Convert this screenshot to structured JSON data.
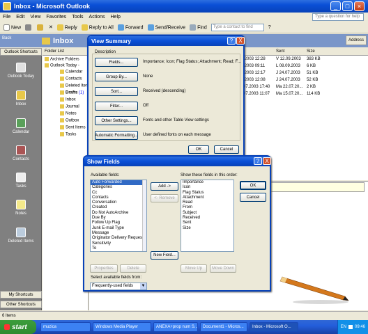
{
  "window": {
    "title": "Inbox - Microsoft Outlook"
  },
  "menu": [
    "File",
    "Edit",
    "View",
    "Favorites",
    "Tools",
    "Actions",
    "Help"
  ],
  "help_placeholder": "Type a question for help",
  "toolbar": {
    "new": "New",
    "reply": "Reply",
    "reply_all": "Reply to All",
    "forward": "Forward",
    "send_receive": "Send/Receive",
    "find": "Find",
    "contact_placeholder": "Type a contact to find"
  },
  "nav": {
    "back": "Back",
    "header": "Inbox",
    "address": "Address"
  },
  "shortcuts": {
    "header": "Outlook Shortcuts",
    "items": [
      "Outlook Today",
      "Inbox",
      "Calendar",
      "Contacts",
      "Tasks",
      "Notes",
      "Deleted Items"
    ],
    "my_shortcuts": "My Shortcuts",
    "other_shortcuts": "Other Shortcuts"
  },
  "folders": {
    "header": "Folder List",
    "items": [
      "Archive Folders",
      "Outlook Today -",
      "Calendar",
      "Contacts",
      "Deleted Items",
      "Drafts",
      "(1)",
      "Inbox",
      "Journal",
      "Notes",
      "Outbox",
      "Sent Items",
      "Tasks"
    ]
  },
  "messages": {
    "columns": [
      "Sent",
      "Size"
    ],
    "rows": [
      {
        "recv": ".2003 12:28",
        "sent": "V 12.09.2003",
        "size": "383 KB"
      },
      {
        "recv": ".2003 09:11",
        "sent": "L 08.09.2003",
        "size": "6 KB"
      },
      {
        "recv": ".2003 12:17",
        "sent": "J 24.07.2003",
        "size": "51 KB"
      },
      {
        "recv": ".2003 12:08",
        "sent": "J 24.07.2003",
        "size": "52 KB"
      },
      {
        "recv": "07.2003 17:40",
        "sent": "Ma 22.07.20...",
        "size": "2 KB"
      },
      {
        "recv": "07.2003 11:07",
        "sent": "Ma 15.07.20...",
        "size": "114 KB"
      }
    ]
  },
  "view_summary": {
    "title": "View Summary",
    "help": "?",
    "close": "X",
    "section": "Description",
    "rows": [
      {
        "button": "Fields...",
        "value": "Importance; Icon; Flag Status; Attachment; Read; F..."
      },
      {
        "button": "Group By...",
        "value": "None"
      },
      {
        "button": "Sort...",
        "value": "Received (descending)"
      },
      {
        "button": "Filter...",
        "value": "Off"
      },
      {
        "button": "Other Settings...",
        "value": "Fonts and other Table View settings"
      },
      {
        "button": "Automatic Formatting...",
        "value": "User defined fonts on each message"
      }
    ],
    "ok": "OK",
    "cancel": "Cancel"
  },
  "show_fields": {
    "title": "Show Fields",
    "help": "?",
    "close": "X",
    "available_label": "Available fields:",
    "available": [
      "Auto Forwarded",
      "Categories",
      "Cc",
      "Contacts",
      "Conversation",
      "Created",
      "Do Not AutoArchive",
      "Due By",
      "Follow Up Flag",
      "Junk E-mail Type",
      "Message",
      "Originator Delivery Requeste",
      "Sensitivity",
      "To"
    ],
    "show_label": "Show these fields in this order:",
    "shown": [
      "Importance",
      "Icon",
      "Flag Status",
      "Attachment",
      "Read",
      "From",
      "Subject",
      "Received",
      "Sent",
      "Size"
    ],
    "add": "Add ->",
    "remove": "<- Remove",
    "new_field": "New Field...",
    "properties": "Properties",
    "delete": "Delete",
    "move_up": "Move Up",
    "move_down": "Move Down",
    "select_from_label": "Select available fields from:",
    "select_from_value": "Frequently-used fields",
    "ok": "OK",
    "cancel": "Cancel"
  },
  "status": {
    "items": "6 Items"
  },
  "taskbar": {
    "start": "start",
    "tasks": [
      "muzica",
      "Windows Media Player",
      "ANEXA+prop num S...",
      "Document1 - Micros...",
      "Inbox - Microsoft O..."
    ],
    "lang": "EN",
    "clock": "09:46"
  }
}
